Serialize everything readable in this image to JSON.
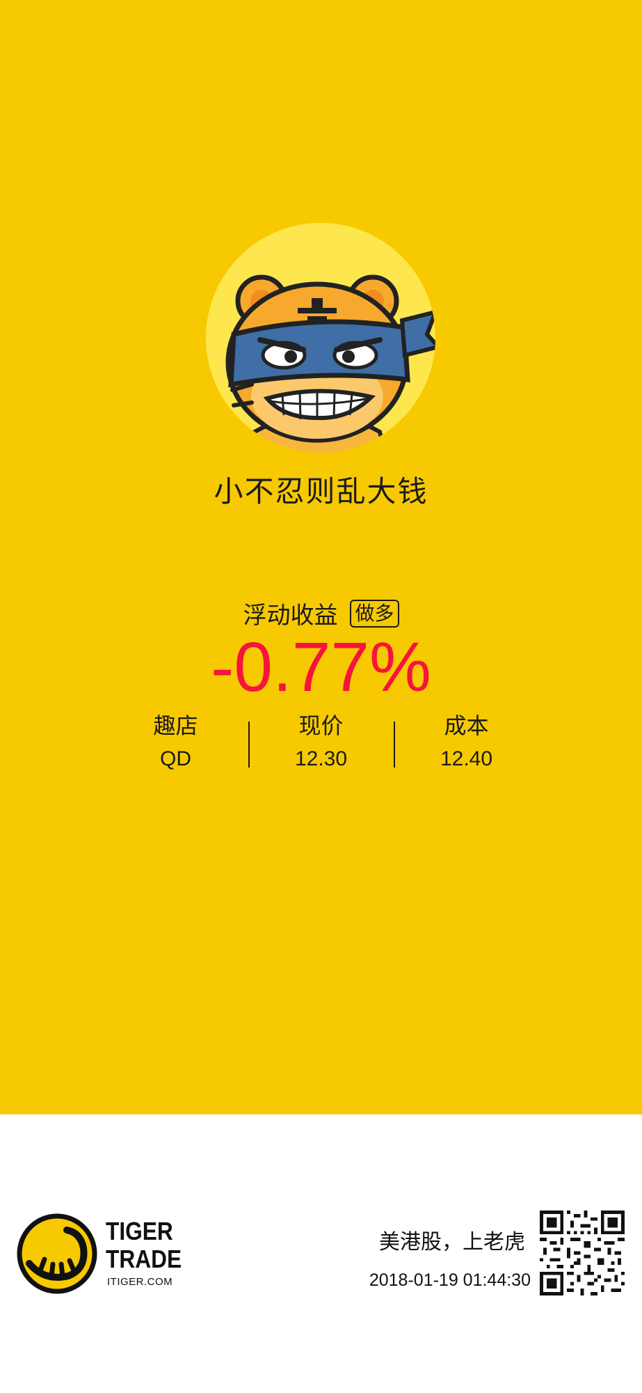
{
  "profile": {
    "nickname": "小不忍则乱大钱",
    "avatar_icon": "tiger-ninja-avatar-icon"
  },
  "pnl": {
    "title": "浮动收益",
    "direction_badge": "做多",
    "value": "-0.77%",
    "value_color": "#F5143C"
  },
  "stats": [
    {
      "label": "趣店",
      "value": "QD"
    },
    {
      "label": "现价",
      "value": "12.30"
    },
    {
      "label": "成本",
      "value": "12.40"
    }
  ],
  "footer": {
    "brand_line1": "TIGER",
    "brand_line2": "TRADE",
    "brand_url": "ITIGER.COM",
    "slogan": "美港股，上老虎",
    "timestamp": "2018-01-19 01:44:30",
    "logo_icon": "tiger-trade-logo-icon",
    "qr_icon": "qr-code-icon"
  },
  "colors": {
    "background_yellow": "#F7C900",
    "loss_red": "#F5143C"
  }
}
